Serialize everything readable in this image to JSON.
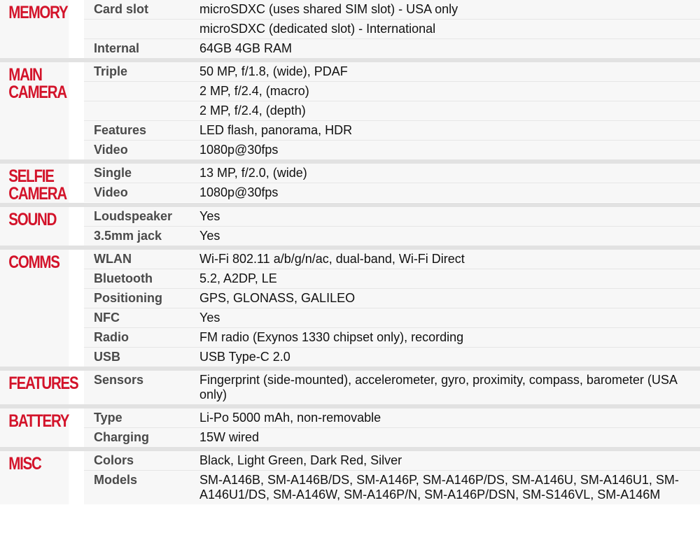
{
  "sections": [
    {
      "title": "MEMORY",
      "rows": [
        {
          "label": "Card slot",
          "value": "microSDXC (uses shared SIM slot) - USA only"
        },
        {
          "label": "",
          "value": "microSDXC (dedicated slot) - International"
        },
        {
          "label": "Internal",
          "value": "64GB 4GB RAM"
        }
      ]
    },
    {
      "title": "MAIN\nCAMERA",
      "rows": [
        {
          "label": "Triple",
          "value": "50 MP, f/1.8, (wide), PDAF"
        },
        {
          "label": "",
          "value": "2 MP, f/2.4, (macro)"
        },
        {
          "label": "",
          "value": "2 MP, f/2.4, (depth)"
        },
        {
          "label": "Features",
          "value": "LED flash, panorama, HDR"
        },
        {
          "label": "Video",
          "value": "1080p@30fps"
        }
      ]
    },
    {
      "title": "SELFIE\nCAMERA",
      "rows": [
        {
          "label": "Single",
          "value": "13 MP, f/2.0, (wide)"
        },
        {
          "label": "Video",
          "value": "1080p@30fps"
        }
      ]
    },
    {
      "title": "SOUND",
      "rows": [
        {
          "label": "Loudspeaker",
          "value": "Yes"
        },
        {
          "label": "3.5mm jack",
          "value": "Yes"
        }
      ]
    },
    {
      "title": "COMMS",
      "rows": [
        {
          "label": "WLAN",
          "value": "Wi-Fi 802.11 a/b/g/n/ac, dual-band, Wi-Fi Direct"
        },
        {
          "label": "Bluetooth",
          "value": "5.2, A2DP, LE"
        },
        {
          "label": "Positioning",
          "value": "GPS, GLONASS, GALILEO"
        },
        {
          "label": "NFC",
          "value": "Yes"
        },
        {
          "label": "Radio",
          "value": "FM radio (Exynos 1330 chipset only), recording"
        },
        {
          "label": "USB",
          "value": "USB Type-C 2.0"
        }
      ]
    },
    {
      "title": "FEATURES",
      "rows": [
        {
          "label": "Sensors",
          "value": "Fingerprint (side-mounted), accelerometer, gyro, proximity, compass, barometer (USA only)"
        }
      ]
    },
    {
      "title": "BATTERY",
      "rows": [
        {
          "label": "Type",
          "value": "Li-Po 5000 mAh, non-removable"
        },
        {
          "label": "Charging",
          "value": "15W wired"
        }
      ]
    },
    {
      "title": "MISC",
      "rows": [
        {
          "label": "Colors",
          "value": "Black, Light Green, Dark Red, Silver"
        },
        {
          "label": "Models",
          "value": "SM-A146B, SM-A146B/DS, SM-A146P, SM-A146P/DS, SM-A146U, SM-A146U1, SM-A146U1/DS, SM-A146W, SM-A146P/N, SM-A146P/DSN, SM-S146VL, SM-A146M"
        }
      ]
    }
  ]
}
